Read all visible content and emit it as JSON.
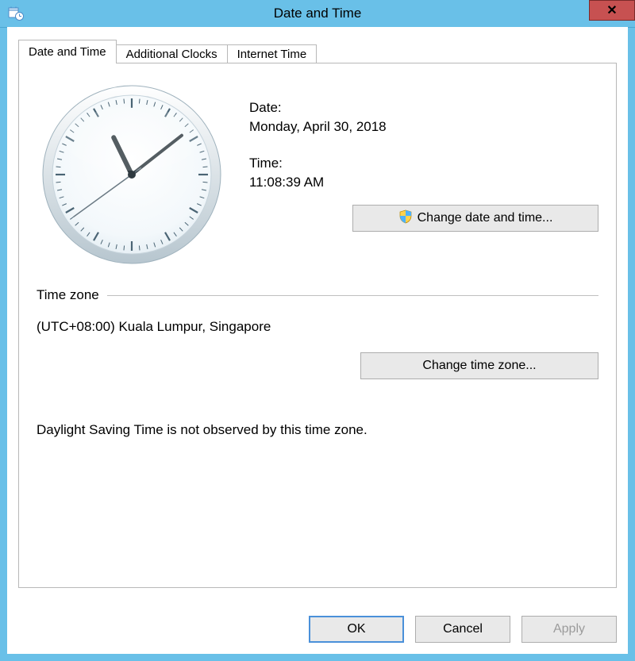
{
  "window": {
    "title": "Date and Time",
    "close_glyph": "✕"
  },
  "tabs": {
    "t0": "Date and Time",
    "t1": "Additional Clocks",
    "t2": "Internet Time"
  },
  "main": {
    "date_label": "Date:",
    "date_value": "Monday, April 30, 2018",
    "time_label": "Time:",
    "time_value": "11:08:39 AM",
    "change_datetime_label": "Change date and time..."
  },
  "timezone": {
    "header": "Time zone",
    "value": "(UTC+08:00) Kuala Lumpur, Singapore",
    "change_tz_label": "Change time zone...",
    "dst_note": "Daylight Saving Time is not observed by this time zone."
  },
  "buttons": {
    "ok": "OK",
    "cancel": "Cancel",
    "apply": "Apply"
  },
  "clock": {
    "hour": 11,
    "minute": 8,
    "second": 39
  }
}
